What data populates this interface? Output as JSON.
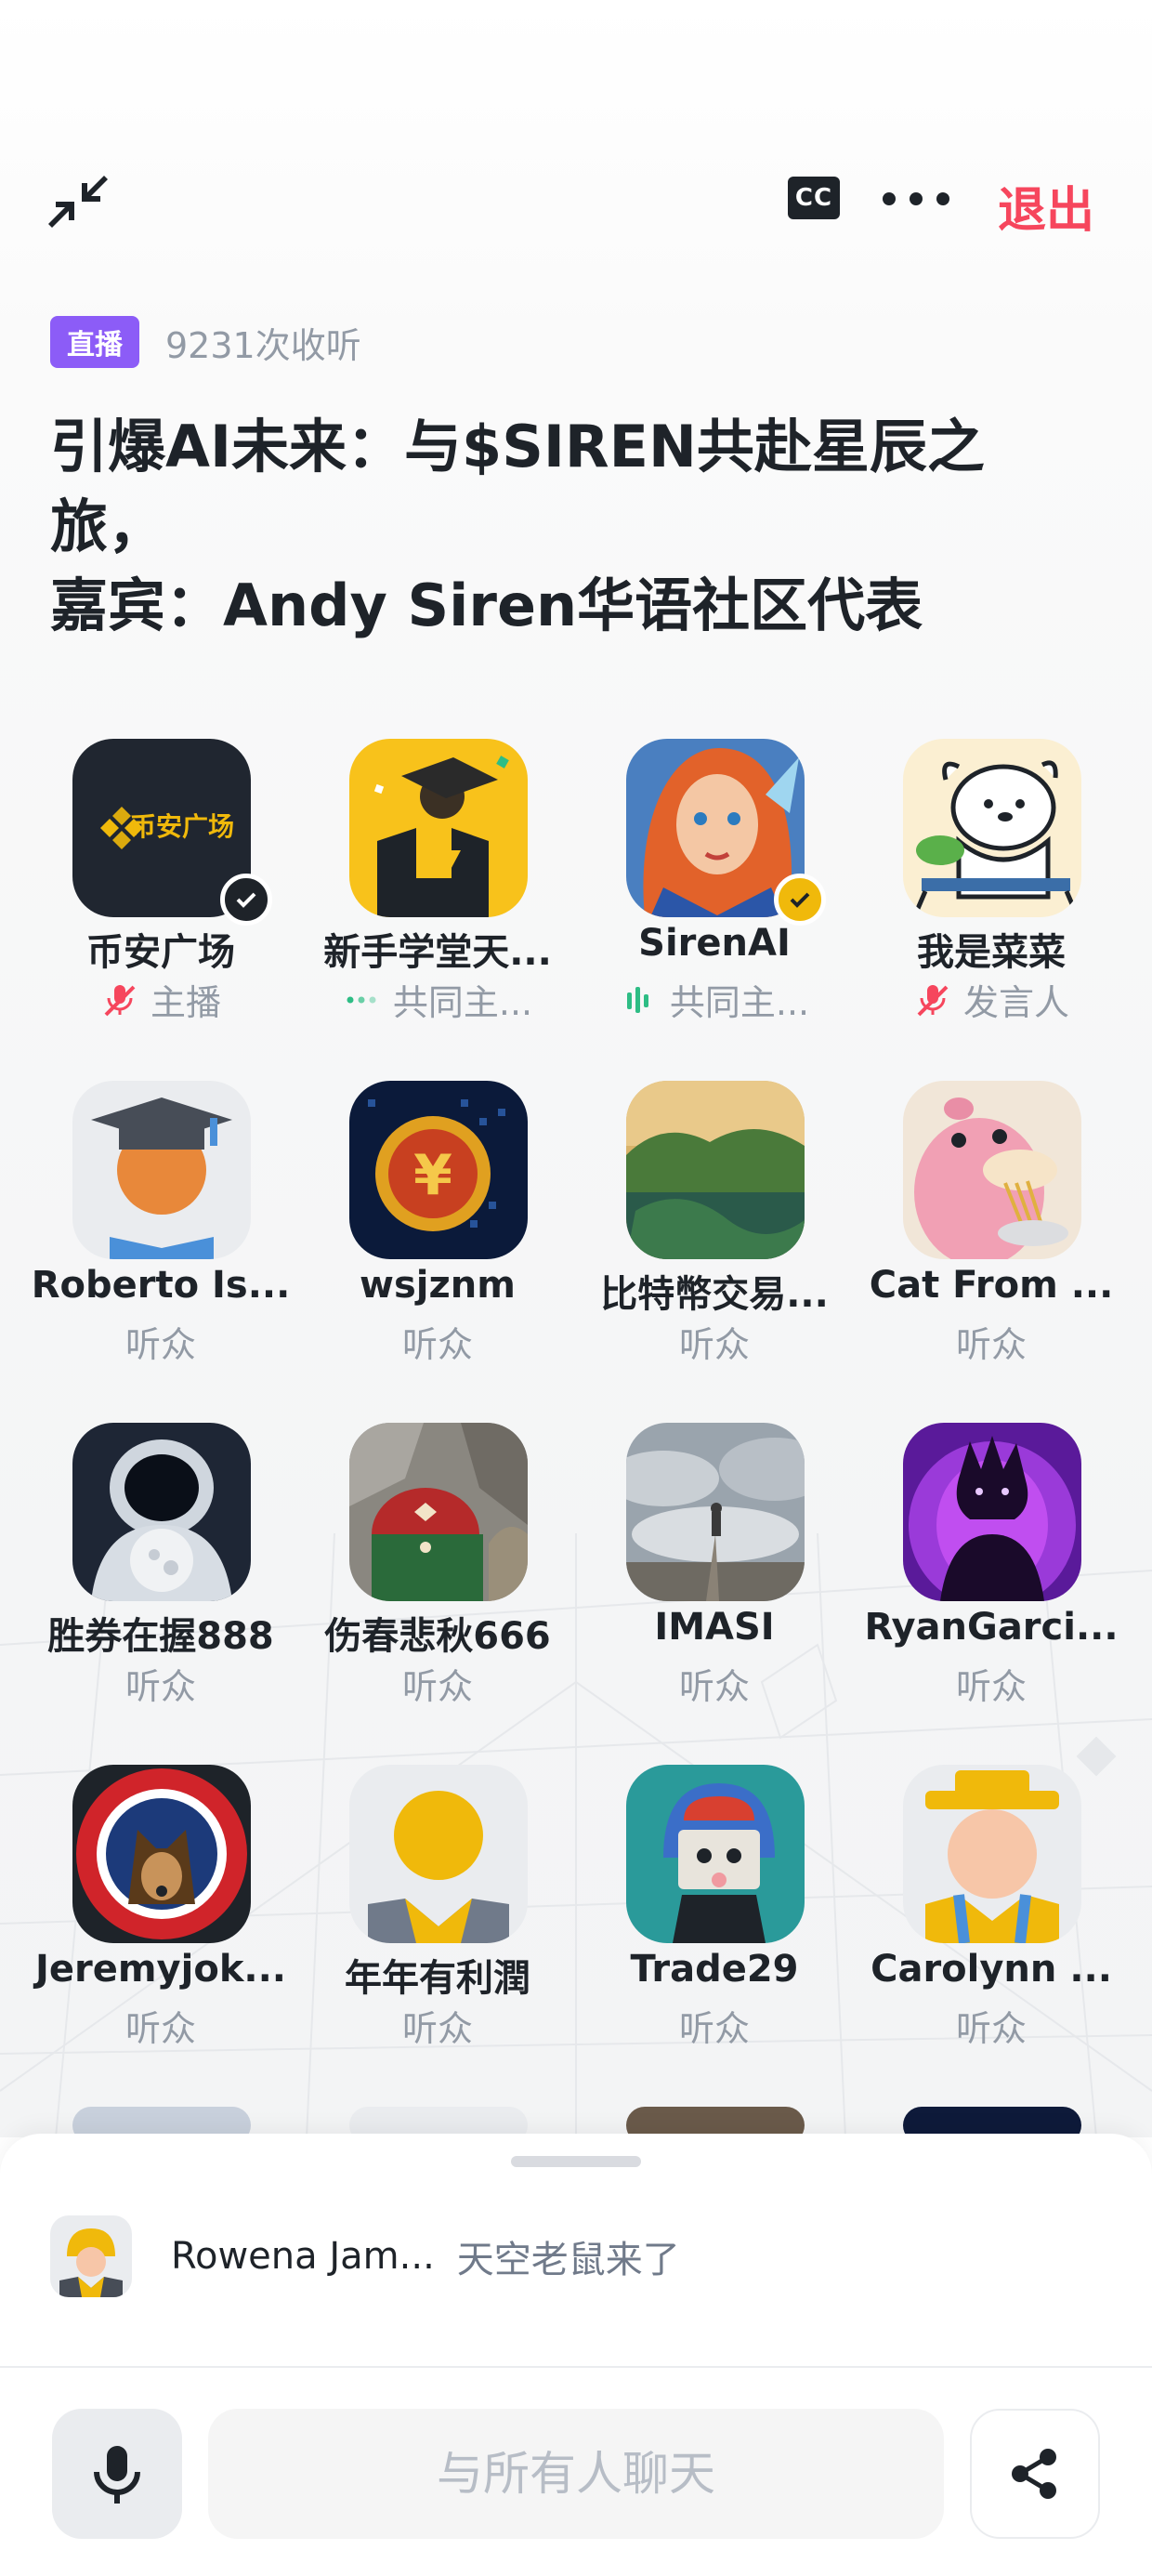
{
  "topbar": {
    "cc_label": "CC",
    "exit_label": "退出"
  },
  "header": {
    "live_badge": "直播",
    "listen_count": "9231次收听",
    "title_lines": [
      "引爆AI未来：与$SIREN共赴星辰之",
      "旅，",
      "嘉宾：Andy  Siren华语社区代表"
    ]
  },
  "participants": [
    {
      "name": "币安广场",
      "role": "主播",
      "role_icon": "mic-muted-icon",
      "avatar": "binance-square-logo",
      "verified": true
    },
    {
      "name": "新手学堂天...",
      "role": "共同主...",
      "role_icon": "dots-icon",
      "avatar": "graduation-cap-illustration",
      "verified": false
    },
    {
      "name": "SirenAI",
      "role": "共同主...",
      "role_icon": "speaking-bars-icon",
      "avatar": "elf-portrait",
      "verified": true
    },
    {
      "name": "我是菜菜",
      "role": "发言人",
      "role_icon": "mic-muted-icon",
      "avatar": "white-bear-illustration",
      "verified": false
    },
    {
      "name": "Roberto Is...",
      "role": "听众",
      "avatar": "default-scholar-avatar"
    },
    {
      "name": "wsjznm",
      "role": "听众",
      "avatar": "gold-coin-digital"
    },
    {
      "name": "比特幣交易...",
      "role": "听众",
      "avatar": "green-island-landscape"
    },
    {
      "name": "Cat From ...",
      "role": "听众",
      "avatar": "pink-slowpoke-eating"
    },
    {
      "name": "胜券在握888",
      "role": "听众",
      "avatar": "astronaut-moon"
    },
    {
      "name": "伤春悲秋666",
      "role": "听众",
      "avatar": "knitted-sweater-photo"
    },
    {
      "name": "IMASI",
      "role": "听众",
      "avatar": "man-walking-clouds"
    },
    {
      "name": "RyanGarci...",
      "role": "听众",
      "avatar": "purple-flame-silhouette"
    },
    {
      "name": "Jeremyjok...",
      "role": "听众",
      "avatar": "conan-dog-badge"
    },
    {
      "name": "年年有利潤",
      "role": "听众",
      "avatar": "default-yellow-avatar"
    },
    {
      "name": "Trade29",
      "role": "听众",
      "avatar": "helmet-character"
    },
    {
      "name": "Carolynn ...",
      "role": "听众",
      "avatar": "default-hat-avatar"
    }
  ],
  "chat": {
    "latest_user": "Rowena Jam...",
    "latest_message": "天空老鼠来了",
    "input_placeholder": "与所有人聊天"
  },
  "colors": {
    "accent_red": "#f6465d",
    "live_purple": "#8c5cf7",
    "verified_gold": "#f0b90b",
    "speaking_green": "#2ebd85",
    "text_primary": "#1e2329",
    "text_secondary": "#929aa5"
  }
}
